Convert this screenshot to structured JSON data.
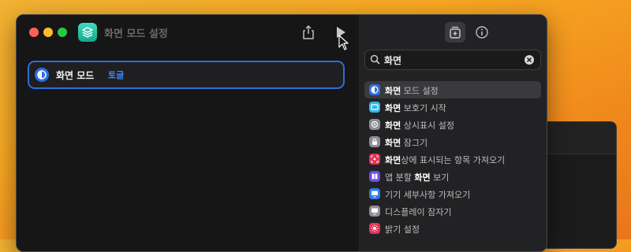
{
  "window": {
    "title": "화면 모드 설정"
  },
  "editor": {
    "action": {
      "label": "화면 모드",
      "param": "토글"
    }
  },
  "sidebar": {
    "search_value": "화면",
    "results": [
      {
        "pre": "",
        "hl": "화면",
        "post": " 모드 설정",
        "icon": "display-mode-icon",
        "color": "#2f6fe0"
      },
      {
        "pre": "",
        "hl": "화면",
        "post": " 보호기 시작",
        "icon": "screensaver-icon",
        "color": "#34b6e8"
      },
      {
        "pre": "",
        "hl": "화면",
        "post": " 상시표시 설정",
        "icon": "always-on-icon",
        "color": "#8e8e93"
      },
      {
        "pre": "",
        "hl": "화면",
        "post": " 잠그기",
        "icon": "lock-icon",
        "color": "#8e8e93"
      },
      {
        "pre": "",
        "hl": "화면",
        "post": "상에 표시되는 항목 가져오기",
        "icon": "screen-capture-icon",
        "color": "#e5335a"
      },
      {
        "pre": "앱 분할 ",
        "hl": "화면",
        "post": " 보기",
        "icon": "split-view-icon",
        "color": "#6c4de0"
      },
      {
        "pre": "기기 세부사항 가져오기",
        "hl": "",
        "post": "",
        "icon": "monitor-icon",
        "color": "#2f7be8"
      },
      {
        "pre": "디스플레이 잠자기",
        "hl": "",
        "post": "",
        "icon": "display-sleep-icon",
        "color": "#8e8e93"
      },
      {
        "pre": "밝기 설정",
        "hl": "",
        "post": "",
        "icon": "brightness-icon",
        "color": "#e5335a"
      }
    ]
  }
}
